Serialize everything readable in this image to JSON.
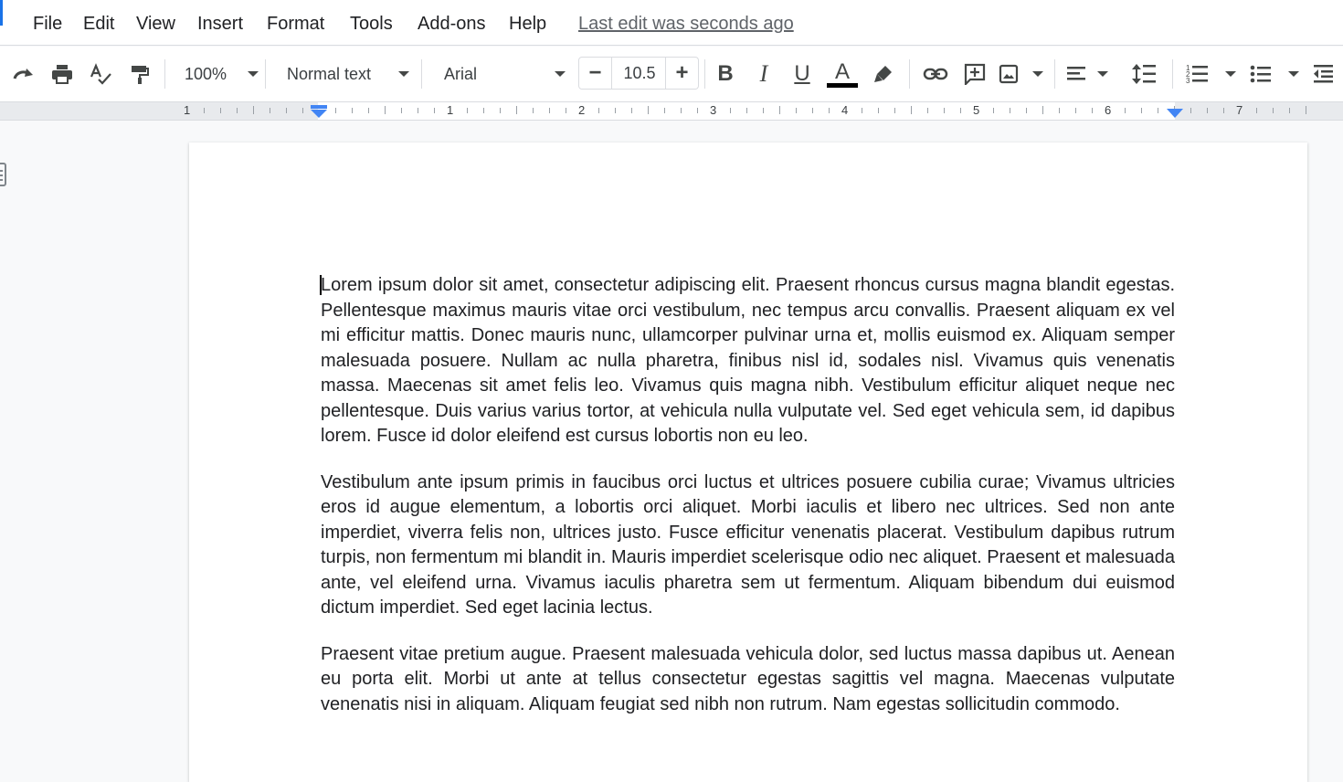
{
  "menu": {
    "items": [
      "File",
      "Edit",
      "View",
      "Insert",
      "Format",
      "Tools",
      "Add-ons",
      "Help"
    ],
    "last_edit": "Last edit was seconds ago"
  },
  "toolbar": {
    "zoom": "100%",
    "style": "Normal text",
    "font": "Arial",
    "font_size": "10.5",
    "text_color": "#000000",
    "icons": [
      "redo-icon",
      "print-icon",
      "spellcheck-icon",
      "paint-format-icon",
      "bold-icon",
      "italic-icon",
      "underline-icon",
      "text-color-icon",
      "highlight-icon",
      "link-icon",
      "comment-icon",
      "image-icon",
      "align-icon",
      "line-spacing-icon",
      "numbered-list-icon",
      "bulleted-list-icon",
      "decrease-indent-icon"
    ]
  },
  "ruler": {
    "numbers": [
      "1",
      "1",
      "2",
      "3",
      "4",
      "5",
      "6",
      "7"
    ],
    "accent": "#4285f4"
  },
  "document": {
    "paragraphs": [
      "Lorem ipsum dolor sit amet, consectetur adipiscing elit. Praesent rhoncus cursus magna blandit egestas. Pellentesque maximus mauris vitae orci vestibulum, nec tempus arcu convallis. Praesent aliquam ex vel mi efficitur mattis. Donec mauris nunc, ullamcorper pulvinar urna et, mollis euismod ex. Aliquam semper malesuada posuere. Nullam ac nulla pharetra, finibus nisl id, sodales nisl. Vivamus quis venenatis massa. Maecenas sit amet felis leo. Vivamus quis magna nibh. Vestibulum efficitur aliquet neque nec pellentesque. Duis varius varius tortor, at vehicula nulla vulputate vel. Sed eget vehicula sem, id dapibus lorem. Fusce id dolor eleifend est cursus lobortis non eu leo.",
      "Vestibulum ante ipsum primis in faucibus orci luctus et ultrices posuere cubilia curae; Vivamus ultricies eros id augue elementum, a lobortis orci aliquet. Morbi iaculis et libero nec ultrices. Sed non ante imperdiet, viverra felis non, ultrices justo. Fusce efficitur venenatis placerat. Vestibulum dapibus rutrum turpis, non fermentum mi blandit in. Mauris imperdiet scelerisque odio nec aliquet. Praesent et malesuada ante, vel eleifend urna. Vivamus iaculis pharetra sem ut fermentum. Aliquam bibendum dui euismod dictum imperdiet. Sed eget lacinia lectus.",
      "Praesent vitae pretium augue. Praesent malesuada vehicula dolor, sed luctus massa dapibus ut. Aenean eu porta elit. Morbi ut ante at tellus consectetur egestas sagittis vel magna. Maecenas vulputate venenatis nisi in aliquam. Aliquam feugiat sed nibh non rutrum. Nam egestas sollicitudin commodo."
    ]
  }
}
